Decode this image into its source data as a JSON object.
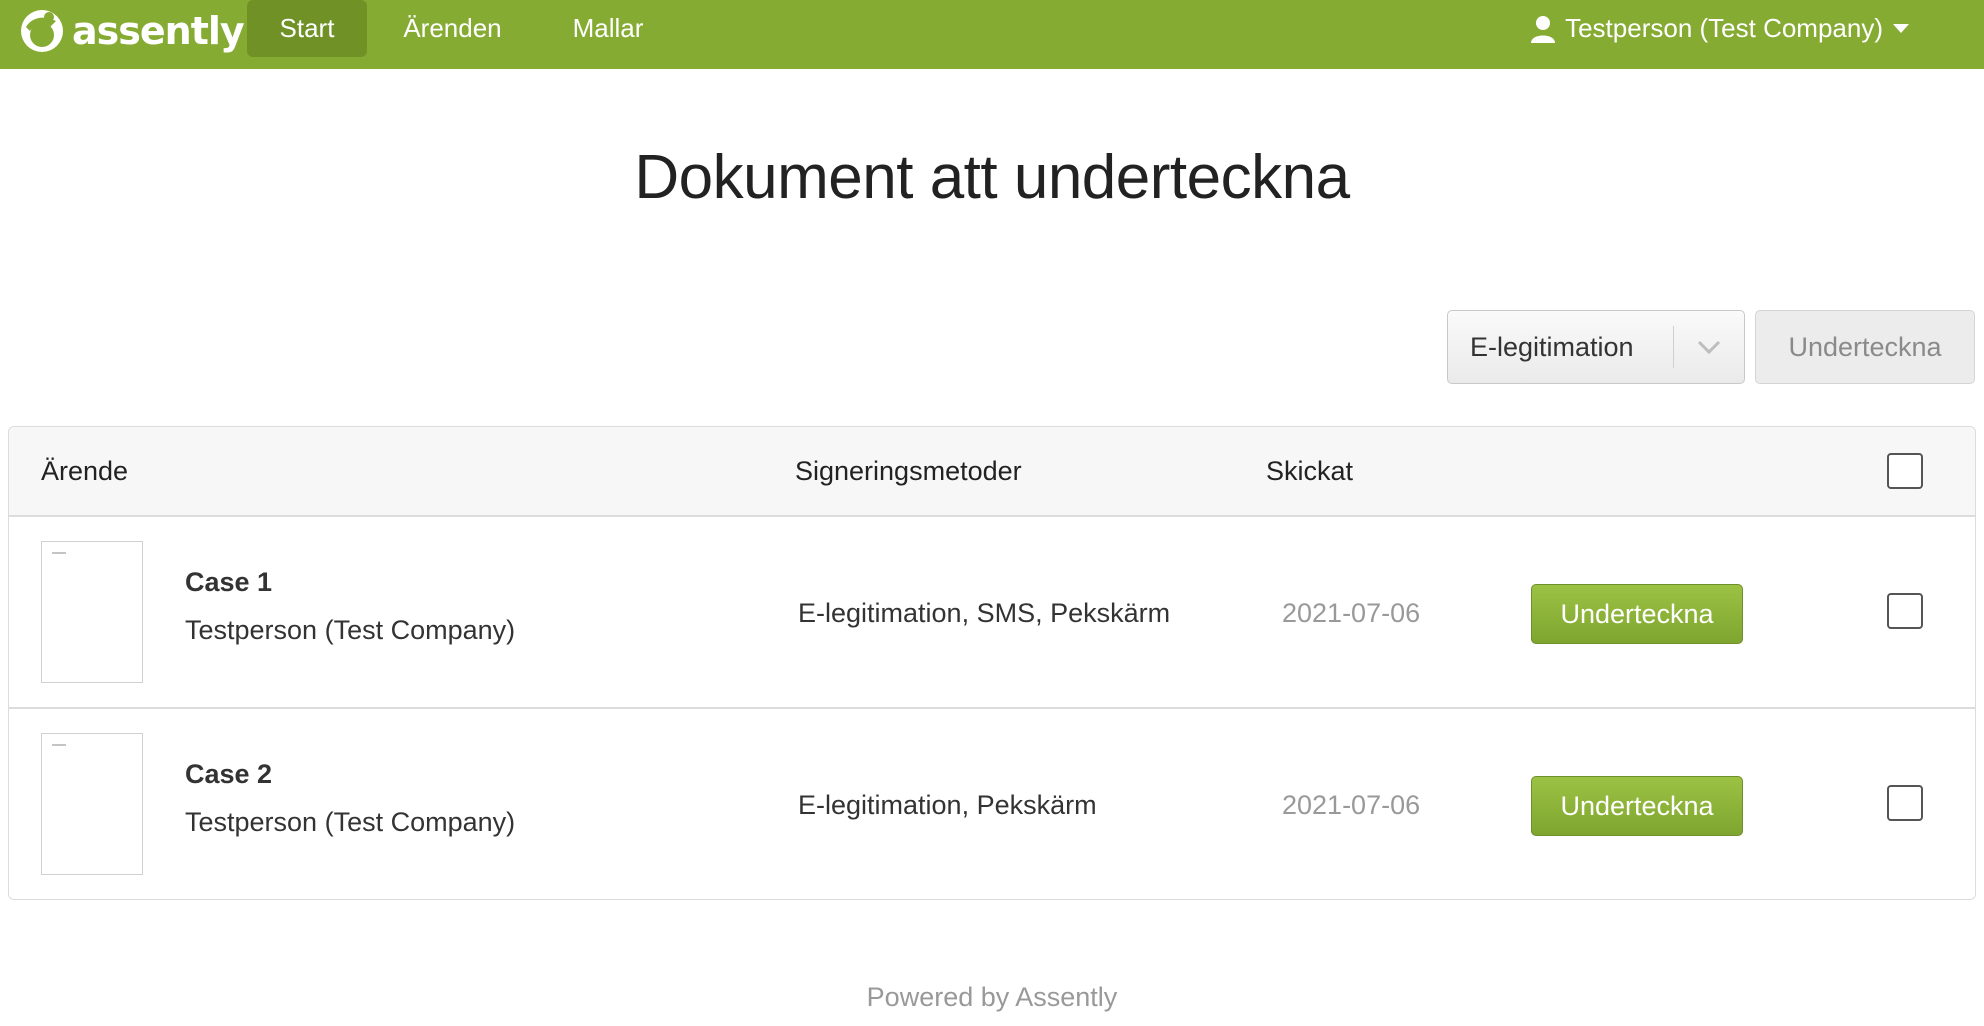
{
  "colors": {
    "brand": "#86ab33",
    "nav_active": "#6f9126",
    "sign_button": "#86ab33"
  },
  "header": {
    "logo_text": "assently",
    "logo_icon": "assently-logo-icon",
    "nav": [
      {
        "label": "Start",
        "active": true
      },
      {
        "label": "Ärenden",
        "active": false
      },
      {
        "label": "Mallar",
        "active": false
      }
    ],
    "user": {
      "label": "Testperson (Test Company)",
      "icon": "user-icon",
      "caret_icon": "caret-down-icon"
    }
  },
  "page": {
    "title": "Dokument att underteckna"
  },
  "toolbar": {
    "method_select": {
      "selected": "E-legitimation",
      "icon": "chevron-down-icon"
    },
    "sign_all_label": "Underteckna"
  },
  "table": {
    "columns": [
      "Ärende",
      "Signeringsmetoder",
      "Skickat"
    ],
    "rows": [
      {
        "title": "Case 1",
        "owner": "Testperson (Test Company)",
        "methods": "E-legitimation, SMS, Pekskärm",
        "sent": "2021-07-06",
        "action_label": "Underteckna",
        "checked": false
      },
      {
        "title": "Case 2",
        "owner": "Testperson (Test Company)",
        "methods": "E-legitimation, Pekskärm",
        "sent": "2021-07-06",
        "action_label": "Underteckna",
        "checked": false
      }
    ]
  },
  "footer": {
    "text": "Powered by Assently"
  }
}
